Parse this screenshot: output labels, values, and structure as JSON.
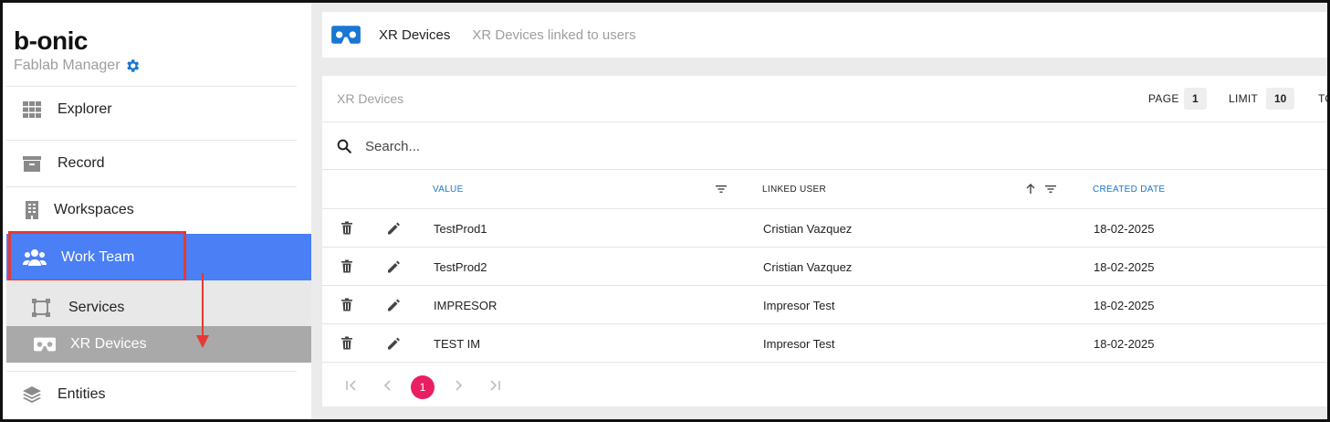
{
  "sidebar": {
    "logo": "b-onic",
    "subtitle": "Fablab Manager",
    "items": {
      "explorer": "Explorer",
      "record": "Record",
      "workspaces": "Workspaces",
      "work_team": "Work Team",
      "services": "Services",
      "xr_devices": "XR Devices",
      "entities": "Entities"
    },
    "accent_color": "#4a7ff5"
  },
  "topbar": {
    "title": "XR Devices",
    "description": "XR Devices linked to users"
  },
  "table_card": {
    "title": "XR Devices",
    "page_label": "PAGE",
    "page_value": "1",
    "limit_label": "LIMIT",
    "limit_value": "10",
    "total_label_partial": "TO",
    "search_placeholder": "Search...",
    "columns": {
      "value": "VALUE",
      "linked_user": "LINKED USER",
      "created_date": "CREATED DATE"
    },
    "rows": [
      {
        "value": "TestProd1",
        "linked_user": "Cristian Vazquez",
        "created_date": "18-02-2025"
      },
      {
        "value": "TestProd2",
        "linked_user": "Cristian Vazquez",
        "created_date": "18-02-2025"
      },
      {
        "value": "IMPRESOR",
        "linked_user": "Impresor Test",
        "created_date": "18-02-2025"
      },
      {
        "value": "TEST IM",
        "linked_user": "Impresor Test",
        "created_date": "18-02-2025"
      }
    ],
    "pagination": {
      "current": "1"
    }
  }
}
